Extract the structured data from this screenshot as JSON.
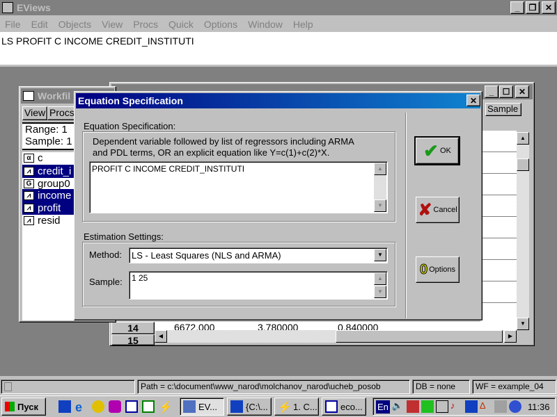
{
  "app": {
    "title": "EViews",
    "menu": [
      "File",
      "Edit",
      "Objects",
      "View",
      "Procs",
      "Quick",
      "Options",
      "Window",
      "Help"
    ],
    "command": "LS  PROFIT C INCOME CREDIT_INSTITUTI"
  },
  "workfile": {
    "title": "Workfil",
    "buttons": [
      "View",
      "Procs"
    ],
    "range": "Range:   1",
    "sample": "Sample: 1",
    "items": [
      {
        "icon": "alpha-icon",
        "glyph": "α",
        "label": "c",
        "selected": false
      },
      {
        "icon": "series-icon",
        "glyph": "",
        "label": "credit_i",
        "selected": true
      },
      {
        "icon": "group-icon",
        "glyph": "G",
        "label": "group0",
        "selected": false
      },
      {
        "icon": "series-icon",
        "glyph": "",
        "label": "income",
        "selected": true
      },
      {
        "icon": "series-icon",
        "glyph": "",
        "label": "profit",
        "selected": true
      },
      {
        "icon": "series-icon",
        "glyph": "",
        "label": "resid",
        "selected": false
      }
    ]
  },
  "spreadsheet": {
    "sample_button": "Sample",
    "rows": [
      {
        "n": "14",
        "values": [
          "6672.000",
          "3.780000",
          "0.840000"
        ]
      },
      {
        "n": "15",
        "values": []
      }
    ]
  },
  "dialog": {
    "title": "Equation Specification",
    "close": "✕",
    "spec_group": "Equation Specification:",
    "hint": "Dependent variable followed by list of regressors including ARMA and PDL terms, OR an explicit equation like Y=c(1)+c(2)*X.",
    "equation": "PROFIT C INCOME CREDIT_INSTITUTI",
    "est_group": "Estimation Settings:",
    "method_label": "Method:",
    "method_value": "LS  -  Least Squares (NLS and ARMA)",
    "sample_label": "Sample:",
    "sample_value": "1 25",
    "ok": "OK",
    "cancel": "Cancel",
    "options": "Options"
  },
  "status": {
    "path": "Path = c:\\document\\www_narod\\molchanov_narod\\ucheb_posob",
    "db": "DB = none",
    "wf": "WF = example_04"
  },
  "taskbar": {
    "start": "Пуск",
    "tasks": [
      "EV...",
      "{C:\\...",
      "1. C...",
      "eco..."
    ],
    "lang": "En",
    "clock": "11:36"
  }
}
